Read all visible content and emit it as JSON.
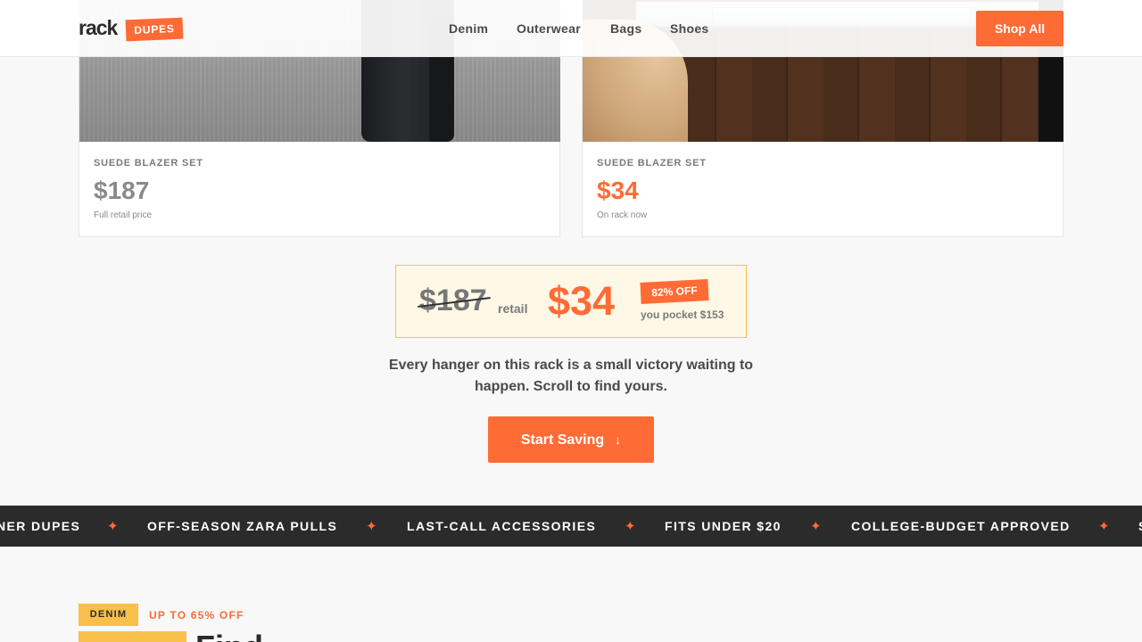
{
  "header": {
    "logo": "rack",
    "logo_badge": "DUPES",
    "nav": [
      "Denim",
      "Outerwear",
      "Bags",
      "Shoes"
    ],
    "shop_all": "Shop All"
  },
  "cards": [
    {
      "label": "SUEDE BLAZER SET",
      "price": "$187",
      "sub": "Full retail price"
    },
    {
      "label": "SUEDE BLAZER SET",
      "price": "$34",
      "sub": "On rack now"
    }
  ],
  "savings": {
    "old_price": "$187",
    "retail_label": "retail",
    "new_price": "$34",
    "off_badge": "82% OFF",
    "pocket": "you pocket $153"
  },
  "tagline": "Every hanger on this rack is a small victory waiting to happen. Scroll to find yours.",
  "cta": {
    "label": "Start Saving",
    "icon": "arrow-down-icon"
  },
  "ticker": [
    "NER DUPES",
    "OFF-SEASON ZARA PULLS",
    "LAST-CALL ACCESSORIES",
    "FITS UNDER $20",
    "COLLEGE-BUDGET APPROVED",
    "S"
  ],
  "section": {
    "category": "DENIM",
    "discount": "UP TO 65% OFF",
    "heading": "Find"
  },
  "colors": {
    "accent": "#ff6b35",
    "highlight": "#f8c04a",
    "ticker_bg": "#2b2b2b"
  }
}
